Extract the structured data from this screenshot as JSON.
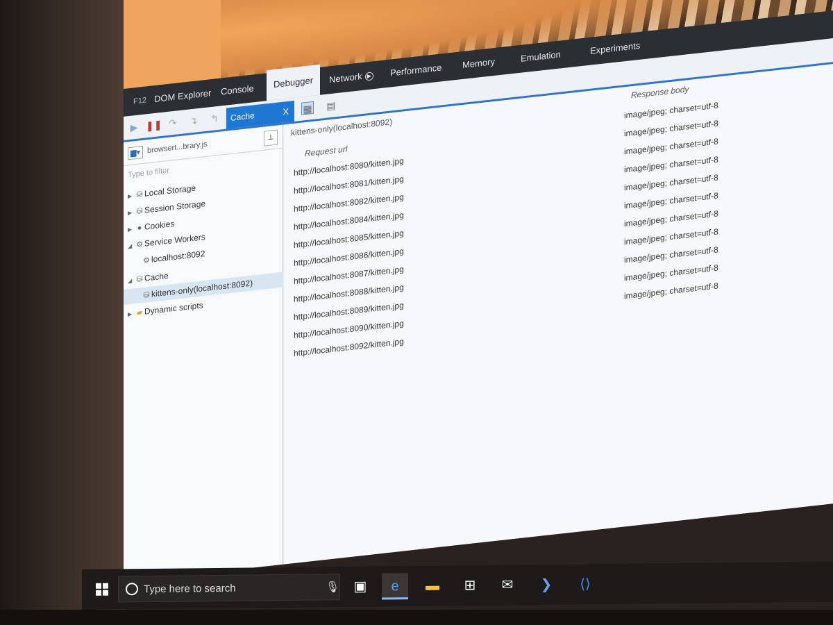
{
  "devtools": {
    "f12_label": "F12",
    "tabs": [
      {
        "label": "DOM Explorer"
      },
      {
        "label": "Console"
      },
      {
        "label": "Debugger"
      },
      {
        "label": "Network"
      },
      {
        "label": "Performance"
      },
      {
        "label": "Memory"
      },
      {
        "label": "Emulation"
      },
      {
        "label": "Experiments"
      }
    ],
    "active_tab": "Debugger"
  },
  "toolbar": {
    "icons": [
      "play-icon",
      "pause-icon",
      "step-over-icon",
      "step-into-icon",
      "step-out-icon",
      "break-on-new-worker-icon",
      "exceptions-icon",
      "deselect-icon",
      "pin-pane-icon",
      "pretty-print-icon"
    ]
  },
  "script_selector": {
    "current": "browsert...brary.js"
  },
  "filter": {
    "placeholder": "Type to filter"
  },
  "tree": [
    {
      "label": "Local Storage",
      "icon": "database-icon",
      "twisty": "collapsed"
    },
    {
      "label": "Session Storage",
      "icon": "database-icon",
      "twisty": "collapsed"
    },
    {
      "label": "Cookies",
      "icon": "cookie-icon",
      "twisty": "collapsed"
    },
    {
      "label": "Service Workers",
      "icon": "gear-icon",
      "twisty": "expanded"
    },
    {
      "label": "localhost:8092",
      "icon": "gear-icon",
      "twisty": "none"
    },
    {
      "label": "Cache",
      "icon": "database-icon",
      "twisty": "expanded"
    },
    {
      "label": "kittens-only(localhost:8092)",
      "icon": "database-icon",
      "twisty": "none",
      "selected": true
    },
    {
      "label": "Dynamic scripts",
      "icon": "folder-icon",
      "twisty": "collapsed"
    }
  ],
  "cache_tab": {
    "label": "Cache",
    "close": "X"
  },
  "cache_view": {
    "title": "kittens-only(localhost:8092)",
    "col_request": "Request url",
    "col_response": "Response body",
    "rows": [
      {
        "url": "http://localhost:8080/kitten.jpg",
        "body": "image/jpeg; charset=utf-8"
      },
      {
        "url": "http://localhost:8081/kitten.jpg",
        "body": "image/jpeg; charset=utf-8"
      },
      {
        "url": "http://localhost:8082/kitten.jpg",
        "body": "image/jpeg; charset=utf-8"
      },
      {
        "url": "http://localhost:8084/kitten.jpg",
        "body": "image/jpeg; charset=utf-8"
      },
      {
        "url": "http://localhost:8085/kitten.jpg",
        "body": "image/jpeg; charset=utf-8"
      },
      {
        "url": "http://localhost:8086/kitten.jpg",
        "body": "image/jpeg; charset=utf-8"
      },
      {
        "url": "http://localhost:8087/kitten.jpg",
        "body": "image/jpeg; charset=utf-8"
      },
      {
        "url": "http://localhost:8088/kitten.jpg",
        "body": "image/jpeg; charset=utf-8"
      },
      {
        "url": "http://localhost:8089/kitten.jpg",
        "body": "image/jpeg; charset=utf-8"
      },
      {
        "url": "http://localhost:8090/kitten.jpg",
        "body": "image/jpeg; charset=utf-8"
      },
      {
        "url": "http://localhost:8092/kitten.jpg",
        "body": "image/jpeg; charset=utf-8"
      }
    ]
  },
  "taskbar": {
    "search_placeholder": "Type here to search",
    "apps": [
      "task-view-icon",
      "edge-icon",
      "file-explorer-icon",
      "store-icon",
      "mail-icon",
      "powershell-icon",
      "vscode-icon"
    ]
  },
  "colors": {
    "accent": "#1e77d3",
    "toolbar_dark": "#2b2f33"
  }
}
